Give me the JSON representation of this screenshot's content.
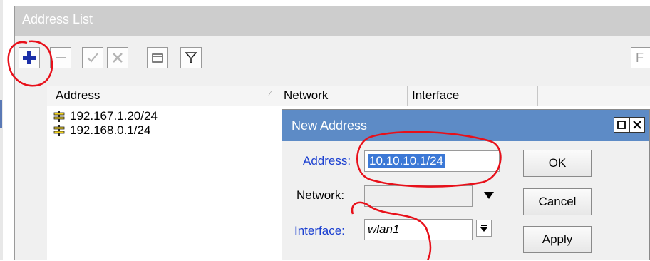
{
  "window": {
    "title": "Address List"
  },
  "toolbar": {
    "add_icon": "plus-icon",
    "remove_icon": "minus-icon",
    "enable_icon": "check-icon",
    "disable_icon": "x-icon",
    "comment_icon": "comment-icon",
    "filter_icon": "filter-icon",
    "find_placeholder": "F"
  },
  "list": {
    "columns": [
      "Address",
      "Network",
      "Interface"
    ],
    "rows": [
      {
        "address": "192.167.1.20/24"
      },
      {
        "address": "192.168.0.1/24"
      }
    ]
  },
  "dialog": {
    "title": "New Address",
    "address_label": "Address:",
    "address_value": "10.10.10.1/24",
    "network_label": "Network:",
    "network_value": "",
    "interface_label": "Interface:",
    "interface_value": "wlan1",
    "ok_label": "OK",
    "cancel_label": "Cancel",
    "apply_label": "Apply"
  },
  "colors": {
    "selection": "#3b78d6",
    "link_label": "#1a3fd0",
    "annotation": "#e8101a"
  }
}
